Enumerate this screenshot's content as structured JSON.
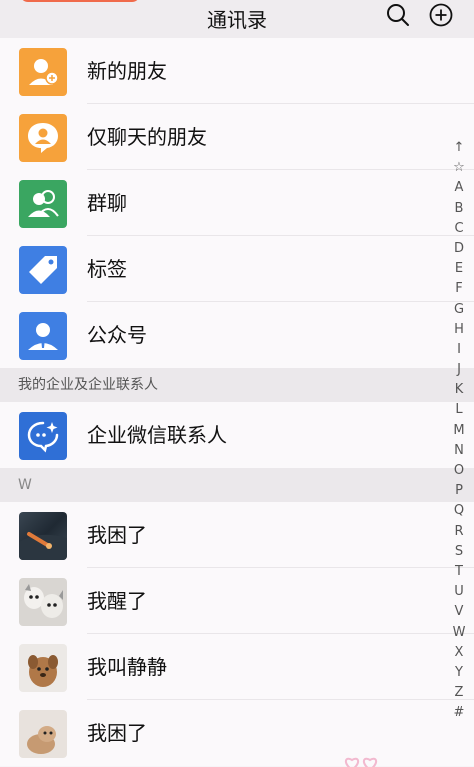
{
  "header": {
    "title": "通讯录",
    "search_icon": "search-icon",
    "add_icon": "add-circle-icon"
  },
  "top_items": [
    {
      "label": "新的朋友",
      "icon": "new-friend-icon",
      "color": "#f6a23b"
    },
    {
      "label": "仅聊天的朋友",
      "icon": "chat-only-friend-icon",
      "color": "#f6a23b"
    },
    {
      "label": "群聊",
      "icon": "group-chat-icon",
      "color": "#3aa661"
    },
    {
      "label": "标签",
      "icon": "tag-icon",
      "color": "#3f7fe3"
    },
    {
      "label": "公众号",
      "icon": "official-account-icon",
      "color": "#3f7fe3"
    }
  ],
  "enterprise_section": {
    "header": "我的企业及企业联系人",
    "item": {
      "label": "企业微信联系人",
      "icon": "wecom-contact-icon",
      "color": "#2f6fd6"
    }
  },
  "w_section": {
    "header": "W",
    "contacts": [
      {
        "label": "我困了",
        "avatar": "landscape-photo"
      },
      {
        "label": "我醒了",
        "avatar": "dogs-photo"
      },
      {
        "label": "我叫静静",
        "avatar": "puppy-photo"
      },
      {
        "label": "我困了",
        "avatar": "pet-photo"
      }
    ]
  },
  "index_bar": [
    "↑",
    "☆",
    "A",
    "B",
    "C",
    "D",
    "E",
    "F",
    "G",
    "H",
    "I",
    "J",
    "K",
    "L",
    "M",
    "N",
    "O",
    "P",
    "Q",
    "R",
    "S",
    "T",
    "U",
    "V",
    "W",
    "X",
    "Y",
    "Z",
    "#"
  ]
}
